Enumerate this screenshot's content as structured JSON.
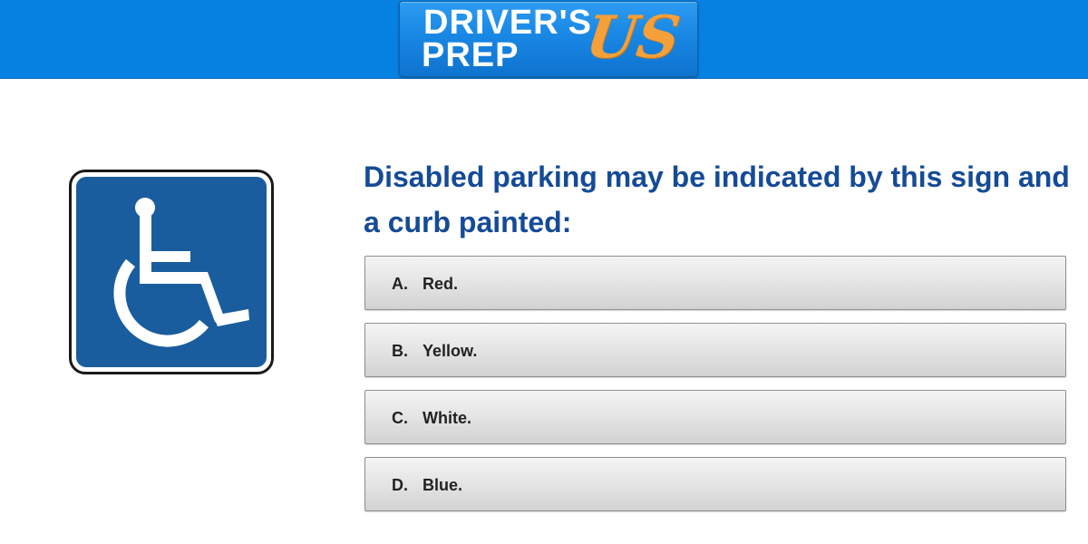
{
  "header": {
    "logo": {
      "line1": "DRIVER'S",
      "line2": "PREP",
      "accent": "US"
    },
    "background_color": "#0681e2"
  },
  "sign": {
    "icon": "wheelchair-accessibility-icon",
    "background_color": "#1a5d9e"
  },
  "question": {
    "text": "Disabled parking may be indicated by this sign and a curb painted:",
    "color": "#154b97"
  },
  "options": [
    {
      "letter": "A.",
      "label": "Red."
    },
    {
      "letter": "B.",
      "label": "Yellow."
    },
    {
      "letter": "C.",
      "label": "White."
    },
    {
      "letter": "D.",
      "label": "Blue."
    }
  ]
}
